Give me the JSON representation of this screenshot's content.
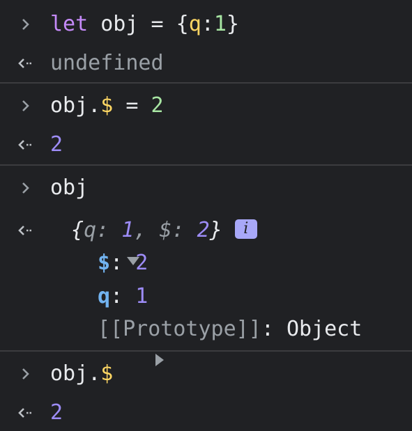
{
  "entries": [
    {
      "input": {
        "keyword": "let",
        "name": "obj",
        "assign": "=",
        "open": "{",
        "prop": "q",
        "colon": ":",
        "value": "1",
        "close": "}"
      },
      "output": "undefined"
    },
    {
      "input": {
        "object": "obj",
        "dot": ".",
        "prop": "$",
        "assign": "=",
        "value": "2"
      },
      "output": "2"
    },
    {
      "input": {
        "text": "obj"
      },
      "output": {
        "preview": {
          "open": "{",
          "k1": "q",
          "sep1": ": ",
          "v1": "1",
          "comma": ", ",
          "k2": "$",
          "sep2": ": ",
          "v2": "2",
          "close": "}"
        },
        "info_label": "i",
        "properties": [
          {
            "key": "$",
            "sep": ": ",
            "value": "2"
          },
          {
            "key": "q",
            "sep": ": ",
            "value": "1"
          }
        ],
        "prototype": {
          "label": "[[Prototype]]",
          "sep": ": ",
          "value": "Object"
        }
      }
    },
    {
      "input": {
        "object": "obj",
        "dot": ".",
        "prop": "$"
      },
      "output": "2"
    }
  ],
  "icons": {
    "input_prompt": "chevron-right-icon",
    "result_arrow": "return-arrow-icon",
    "expand_open": "triangle-down-icon",
    "expand_closed": "triangle-right-icon"
  },
  "colors": {
    "background": "#202124",
    "keyword": "#c58af9",
    "property_name": "#fdd663",
    "number_result": "#9d8cf7",
    "string_green": "#a8e6a3",
    "object_key": "#72b3f0",
    "muted": "#9aa0a6",
    "info_badge": "#a8a8f8"
  }
}
